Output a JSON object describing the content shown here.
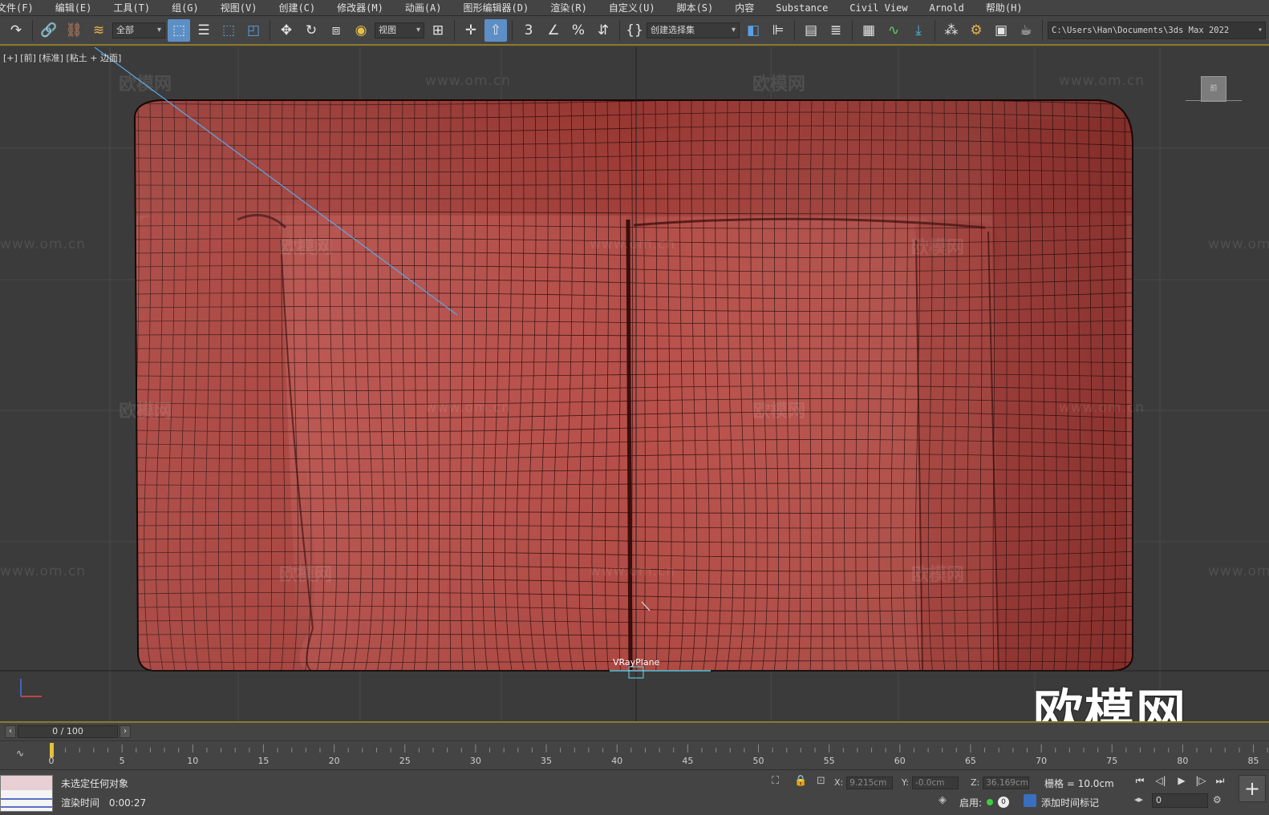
{
  "menubar": {
    "items": [
      "文件(F)",
      "编辑(E)",
      "工具(T)",
      "组(G)",
      "视图(V)",
      "创建(C)",
      "修改器(M)",
      "动画(A)",
      "图形编辑器(D)",
      "渲染(R)",
      "自定义(U)",
      "脚本(S)",
      "内容",
      "Substance",
      "Civil View",
      "Arnold",
      "帮助(H)"
    ]
  },
  "toolbar": {
    "selection_filter": "全部",
    "ref_coord": "视图",
    "named_selection": "创建选择集",
    "project_path": "C:\\Users\\Han\\Documents\\3ds Max 2022",
    "snap_label": "3"
  },
  "viewport": {
    "label": "[+] [前] [标准] [粘土 + 边面]",
    "object_label": "VRayPlane",
    "viewcube_label": "前",
    "watermark_cn": "欧模网",
    "watermark_url": "www.om.cn",
    "logo_text": "欧模网",
    "mesh_color": "#b3453f",
    "background_color": "#3b3b3b"
  },
  "timeline": {
    "frame_display": "0 / 100",
    "current_frame": 0,
    "ticks": [
      0,
      5,
      10,
      15,
      20,
      25,
      30,
      35,
      40,
      45,
      50,
      55,
      60,
      65,
      70,
      75,
      80,
      85
    ]
  },
  "status": {
    "message": "未选定任何对象",
    "render_time_label": "渲染时间",
    "render_time_value": "0:00:27",
    "x_label": "X:",
    "x_value": "9.215cm",
    "y_label": "Y:",
    "y_value": "-0.0cm",
    "z_label": "Z:",
    "z_value": "36.169cm",
    "grid_text": "栅格 = 10.0cm",
    "enable_label": "启用:",
    "key_count": "0",
    "add_tag_label": "添加时间标记",
    "frame_value": "0"
  }
}
